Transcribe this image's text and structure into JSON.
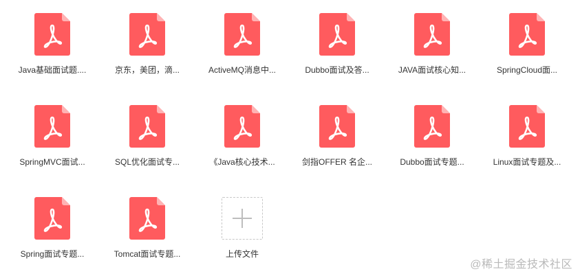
{
  "files": [
    {
      "name": "Java基础面试题....",
      "icon": "pdf-file-icon"
    },
    {
      "name": "京东，美团，滴...",
      "icon": "pdf-file-icon"
    },
    {
      "name": "ActiveMQ消息中...",
      "icon": "pdf-file-icon"
    },
    {
      "name": "Dubbo面试及答...",
      "icon": "pdf-file-icon"
    },
    {
      "name": "JAVA面试核心知...",
      "icon": "pdf-file-icon"
    },
    {
      "name": "SpringCloud面...",
      "icon": "pdf-file-icon"
    },
    {
      "name": "SpringMVC面试...",
      "icon": "pdf-file-icon"
    },
    {
      "name": "SQL优化面试专...",
      "icon": "pdf-file-icon"
    },
    {
      "name": "《Java核心技术...",
      "icon": "pdf-file-icon"
    },
    {
      "name": "剑指OFFER  名企...",
      "icon": "pdf-file-icon"
    },
    {
      "name": "Dubbo面试专题...",
      "icon": "pdf-file-icon"
    },
    {
      "name": "Linux面试专题及...",
      "icon": "pdf-file-icon"
    },
    {
      "name": "Spring面试专题...",
      "icon": "pdf-file-icon"
    },
    {
      "name": "Tomcat面试专题...",
      "icon": "pdf-file-icon"
    }
  ],
  "upload": {
    "label": "上传文件",
    "icon": "plus-icon"
  },
  "watermark": "@稀土掘金技术社区",
  "colors": {
    "pdf_red": "#ff5b5e",
    "pdf_fold": "#ffb3b4",
    "text": "#333333"
  }
}
